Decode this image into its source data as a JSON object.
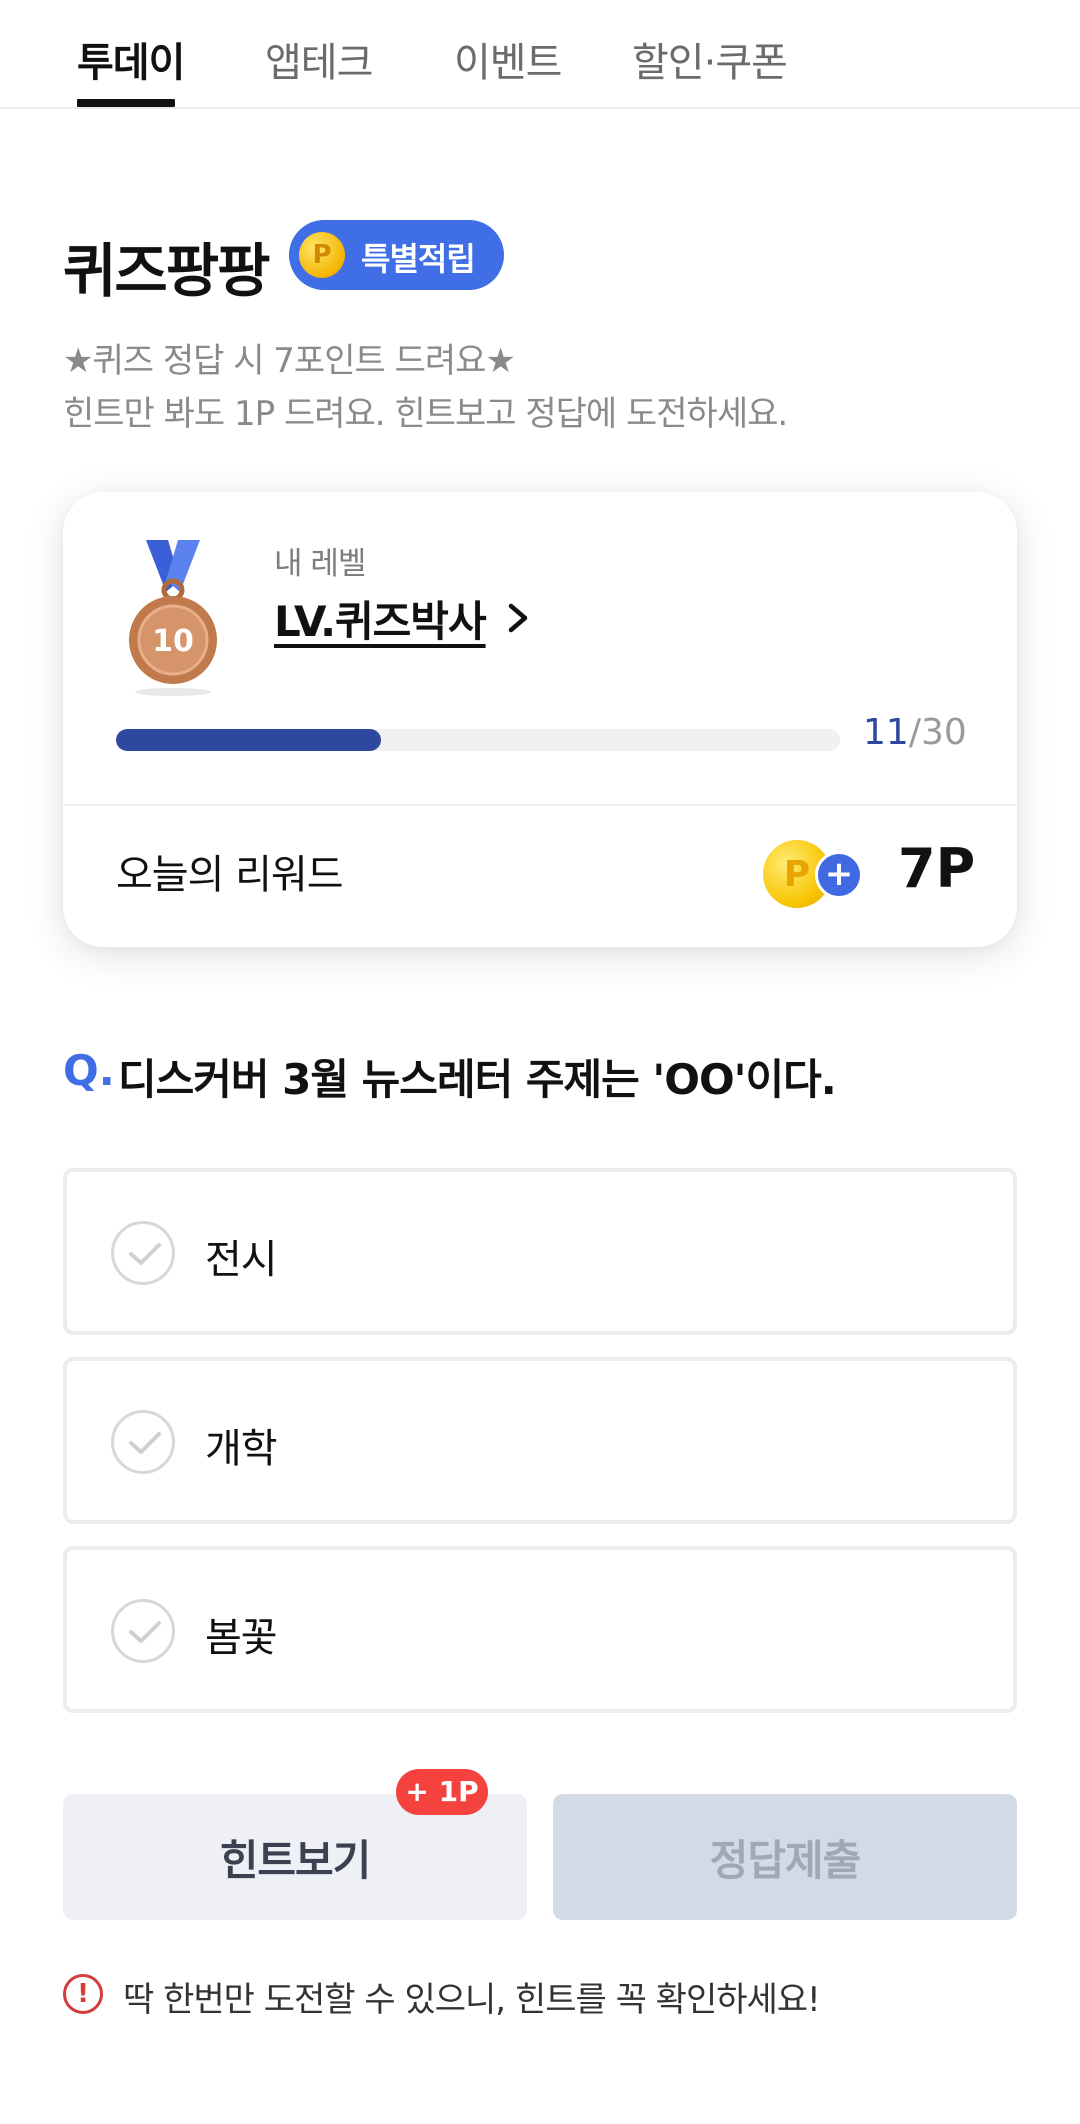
{
  "tabs": [
    {
      "label": "투데이",
      "active": true
    },
    {
      "label": "앱테크",
      "active": false
    },
    {
      "label": "이벤트",
      "active": false
    },
    {
      "label": "할인·쿠폰",
      "active": false
    }
  ],
  "header": {
    "title": "퀴즈팡팡",
    "badge_label": "특별적립",
    "badge_coin": "P",
    "description": [
      "★퀴즈 정답 시 7포인트 드려요★",
      "힌트만 봐도 1P 드려요. 힌트보고 정답에 도전하세요."
    ]
  },
  "level_card": {
    "caption": "내 레벨",
    "level_name": "LV.퀴즈박사",
    "medal_number": "10",
    "progress_current": "11",
    "progress_total": "/30",
    "progress_fraction": 0.3667,
    "reward_label": "오늘의 리워드",
    "reward_coin": "P",
    "reward_plus": "+",
    "reward_value": "7P"
  },
  "question": {
    "mark": "Q.",
    "text": "디스커버 3월 뉴스레터 주제는 'OO'이다."
  },
  "options": [
    {
      "label": "전시"
    },
    {
      "label": "개학"
    },
    {
      "label": "봄꽃"
    }
  ],
  "buttons": {
    "hint_label": "힌트보기",
    "hint_badge": "+ 1P",
    "submit_label": "정답제출"
  },
  "notice": {
    "icon": "!",
    "text": "딱 한번만 도전할 수 있으니, 힌트를 꼭 확인하세요!"
  },
  "colors": {
    "accent": "#3f6ee6",
    "progress": "#2f489f",
    "hint_badge": "#f4433f",
    "notice": "#d23c3c"
  }
}
